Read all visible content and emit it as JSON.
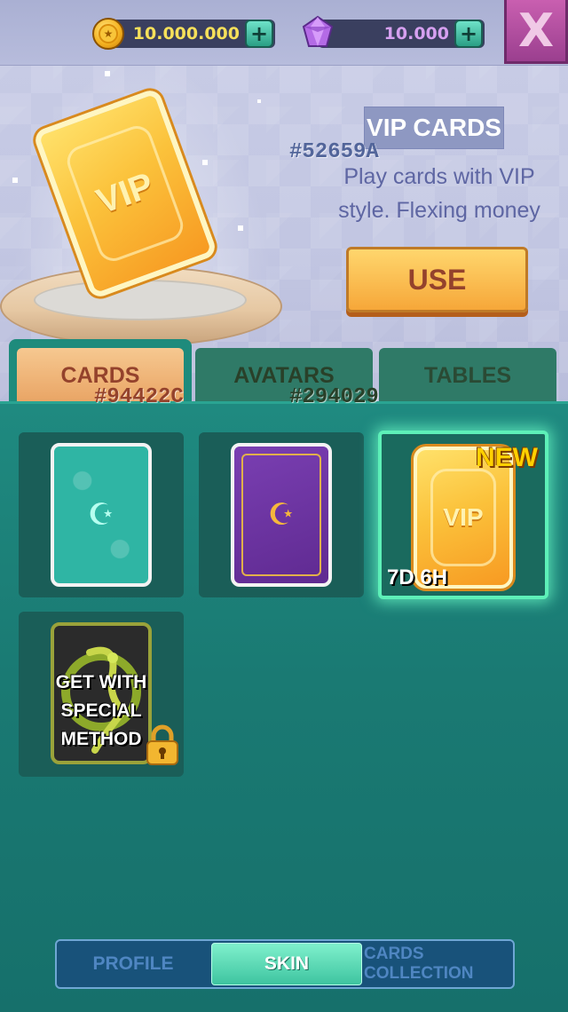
{
  "header": {
    "coins": {
      "value": "10.000.000",
      "add_label": "+"
    },
    "gems": {
      "value": "10.000",
      "add_label": "+"
    },
    "close_label": "X"
  },
  "showcase": {
    "card_label": "VIP",
    "title": "VIP CARDS",
    "description": "Play cards with VIP style. Flexing money",
    "use_label": "USE"
  },
  "color_labels": {
    "title_color": "#52659A",
    "cards_tab_color": "#94422C",
    "avatars_tab_color": "#294029"
  },
  "tabs": [
    {
      "label": "CARDS",
      "active": true
    },
    {
      "label": "AVATARS",
      "active": false
    },
    {
      "label": "TABLES",
      "active": false
    }
  ],
  "items": [
    {
      "style": "teal-crescent",
      "icon": "crescent-star-icon"
    },
    {
      "style": "purple-crescent",
      "icon": "crescent-star-icon"
    },
    {
      "style": "vip",
      "card_label": "VIP",
      "badge": "NEW",
      "timer": "7D 6H",
      "selected": true
    },
    {
      "style": "dragon",
      "locked": true,
      "locked_text": "GET WITH SPECIAL METHOD",
      "icon": "padlock-icon"
    }
  ],
  "bottom_nav": [
    {
      "label": "PROFILE",
      "active": false
    },
    {
      "label": "SKIN",
      "active": true
    },
    {
      "label": "CARDS COLLECTION",
      "active": false
    }
  ],
  "colors": {
    "accent_teal": "#1d7a74",
    "selected_glow": "#5df0b8",
    "use_button_text": "#94422c",
    "coin_text": "#f6e05a",
    "gem_text": "#d6a0f0"
  }
}
